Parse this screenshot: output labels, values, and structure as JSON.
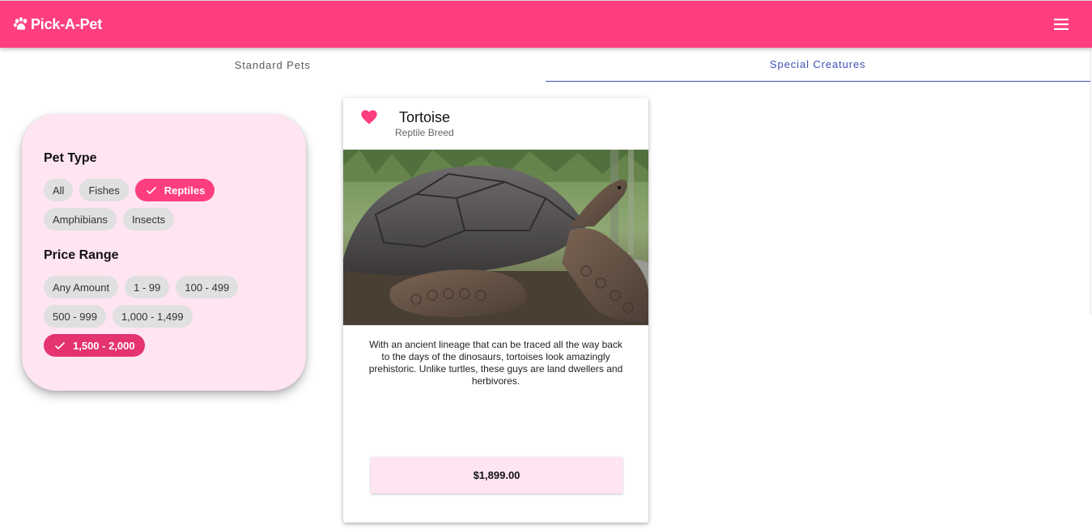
{
  "app": {
    "title": "Pick-A-Pet",
    "brand_icon": "paw-icon",
    "menu_icon": "hamburger-menu-icon",
    "accent_color": "#ff3e7f"
  },
  "tabs": [
    {
      "label": "Standard Pets",
      "active": false
    },
    {
      "label": "Special Creatures",
      "active": true
    }
  ],
  "filters": {
    "pet_type": {
      "heading": "Pet Type",
      "options": [
        {
          "label": "All",
          "selected": false
        },
        {
          "label": "Fishes",
          "selected": false
        },
        {
          "label": "Reptiles",
          "selected": true
        },
        {
          "label": "Amphibians",
          "selected": false
        },
        {
          "label": "Insects",
          "selected": false
        }
      ]
    },
    "price_range": {
      "heading": "Price Range",
      "options": [
        {
          "label": "Any Amount",
          "selected": false
        },
        {
          "label": "1 - 99",
          "selected": false
        },
        {
          "label": "100 - 499",
          "selected": false
        },
        {
          "label": "500 - 999",
          "selected": false
        },
        {
          "label": "1,000 - 1,499",
          "selected": false
        },
        {
          "label": "1,500 - 2,000",
          "selected": true
        }
      ]
    }
  },
  "pet": {
    "name": "Tortoise",
    "breed": "Reptile Breed",
    "favorite": true,
    "favorite_icon": "heart-icon",
    "photo": "giant-tortoise-photo",
    "description": "With an ancient lineage that can be traced all the way back to the days of the dinosaurs, tortoises look amazingly prehistoric. Unlike turtles, these guys are land dwellers and herbivores.",
    "price": "$1,899.00"
  }
}
